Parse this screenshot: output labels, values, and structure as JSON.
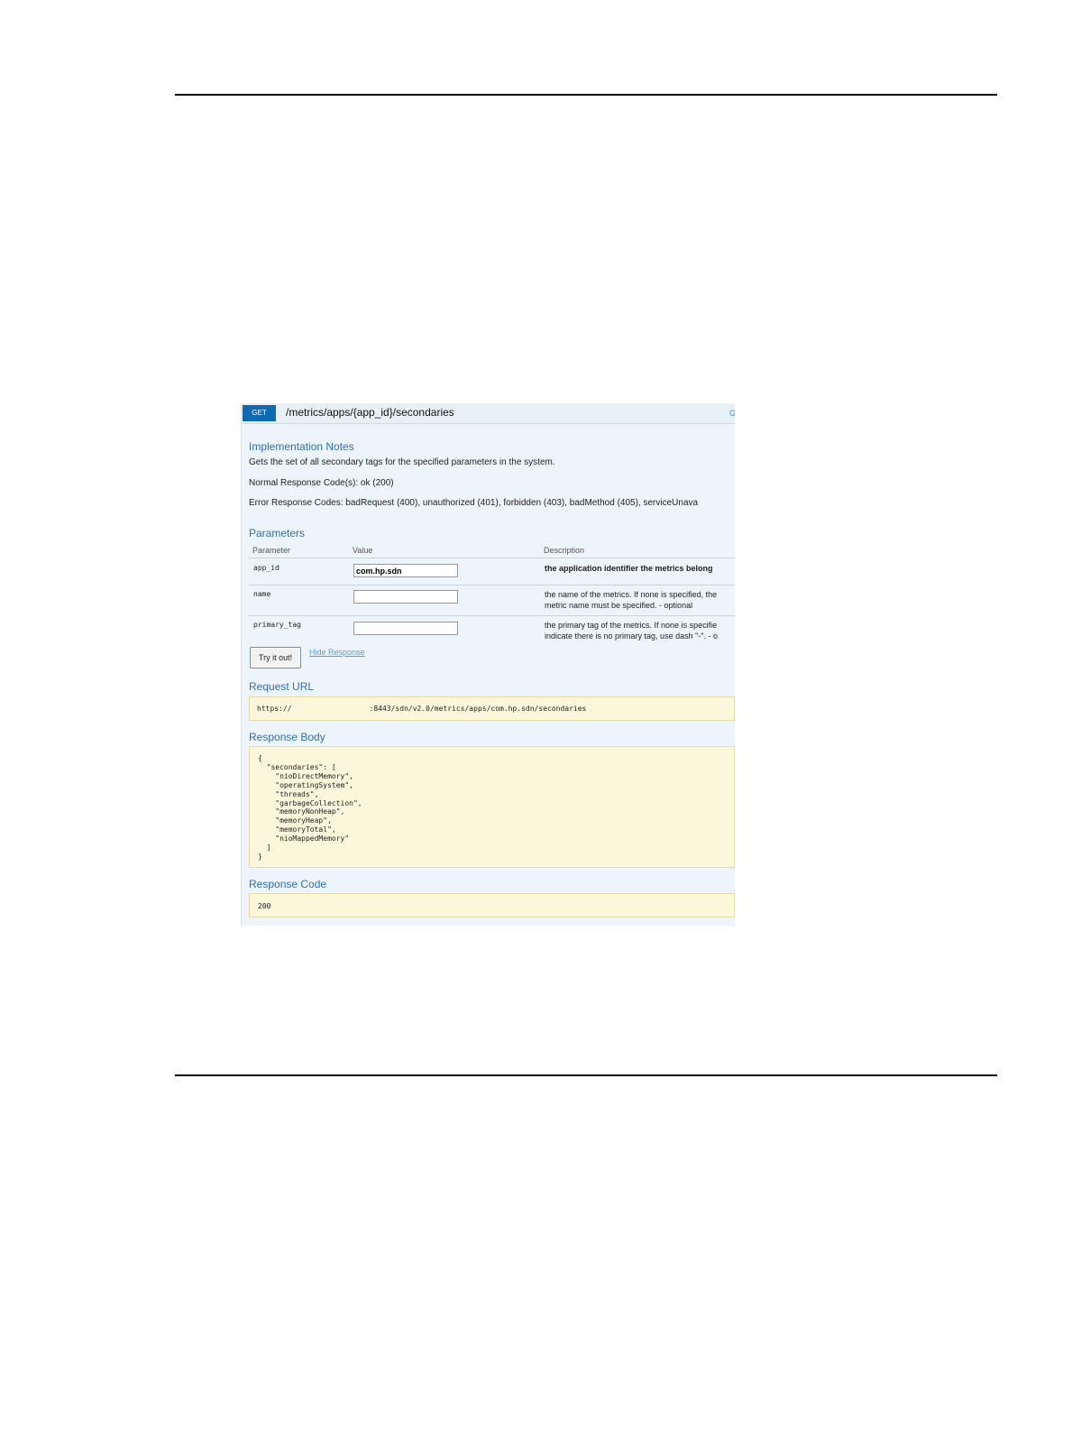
{
  "operation": {
    "method": "GET",
    "path": "/metrics/apps/{app_id}/secondaries",
    "link_fragment": "G"
  },
  "implementation_notes": {
    "heading": "Implementation Notes",
    "summary": "Gets the set of all secondary tags for the specified parameters in the system.",
    "normal_codes": "Normal Response Code(s): ok (200)",
    "error_codes": "Error Response Codes: badRequest (400), unauthorized (401), forbidden (403), badMethod (405), serviceUnava"
  },
  "parameters": {
    "heading": "Parameters",
    "columns": [
      "Parameter",
      "Value",
      "Description"
    ],
    "rows": [
      {
        "name": "app_id",
        "value": "com.hp.sdn",
        "description": [
          "the application identifier the metrics belong"
        ],
        "bold": true
      },
      {
        "name": "name",
        "value": "",
        "description": [
          "the name of the metrics. If none is specified, the",
          "metric name must be specified. - optional"
        ],
        "bold": false
      },
      {
        "name": "primary_tag",
        "value": "",
        "description": [
          "the primary tag of the metrics. If none is specifie",
          "indicate there is no primary tag, use dash \"-\". - o"
        ],
        "bold": false
      }
    ]
  },
  "actions": {
    "try_label": "Try it out!",
    "hide_label": "Hide Response"
  },
  "request_url": {
    "heading": "Request URL",
    "prefix": "https://",
    "suffix": ":8443/sdn/v2.0/metrics/apps/com.hp.sdn/secondaries"
  },
  "response_body": {
    "heading": "Response Body",
    "text": "{\n  \"secondaries\": [\n    \"nioDirectMemory\",\n    \"operatingSystem\",\n    \"threads\",\n    \"garbageCollection\",\n    \"memoryNonHeap\",\n    \"memoryHeap\",\n    \"memoryTotal\",\n    \"nioMappedMemory\"\n  ]\n}"
  },
  "response_code": {
    "heading": "Response Code",
    "value": "200"
  }
}
